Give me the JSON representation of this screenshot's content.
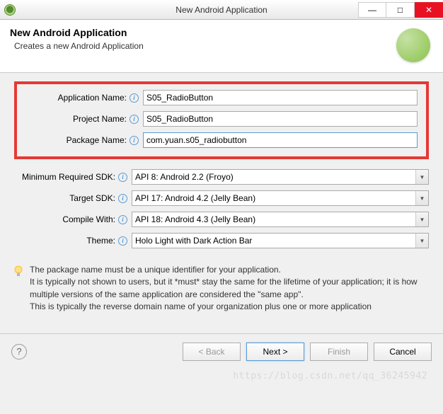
{
  "window": {
    "title": "New Android Application"
  },
  "header": {
    "title": "New Android Application",
    "subtitle": "Creates a new Android Application"
  },
  "form": {
    "app_name_label": "Application Name:",
    "app_name_value": "S05_RadioButton",
    "project_name_label": "Project Name:",
    "project_name_value": "S05_RadioButton",
    "package_name_label": "Package Name:",
    "package_name_value": "com.yuan.s05_radiobutton",
    "min_sdk_label": "Minimum Required SDK:",
    "min_sdk_value": "API 8: Android 2.2 (Froyo)",
    "target_sdk_label": "Target SDK:",
    "target_sdk_value": "API 17: Android 4.2 (Jelly Bean)",
    "compile_with_label": "Compile With:",
    "compile_with_value": "API 18: Android 4.3 (Jelly Bean)",
    "theme_label": "Theme:",
    "theme_value": "Holo Light with Dark Action Bar"
  },
  "hint": {
    "text": "The package name must be a unique identifier for your application.\nIt is typically not shown to users, but it *must* stay the same for the lifetime of your application; it is how multiple versions of the same application are considered the \"same app\".\nThis is typically the reverse domain name of your organization plus one or more application"
  },
  "buttons": {
    "back": "< Back",
    "next": "Next >",
    "finish": "Finish",
    "cancel": "Cancel"
  },
  "watermark": "https://blog.csdn.net/qq_36245942"
}
